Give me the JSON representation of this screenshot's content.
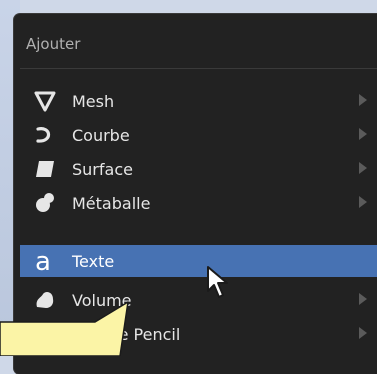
{
  "menu": {
    "title": "Ajouter",
    "items": [
      {
        "label": "Mesh",
        "icon": "mesh-icon",
        "submenu": true
      },
      {
        "label": "Courbe",
        "icon": "curve-icon",
        "submenu": true
      },
      {
        "label": "Surface",
        "icon": "surface-icon",
        "submenu": true
      },
      {
        "label": "Métaballe",
        "icon": "metaball-icon",
        "submenu": true
      },
      {
        "label": "Texte",
        "icon": "text-icon",
        "selected": true,
        "submenu": false
      },
      {
        "label": "Volume",
        "icon": "volume-icon",
        "submenu": true
      },
      {
        "label": "Grease Pencil",
        "icon": "grease-pencil-icon",
        "submenu": true
      }
    ]
  },
  "colors": {
    "menu_bg": "#222222",
    "highlight": "#4772b3",
    "callout": "#fbf4a6"
  }
}
